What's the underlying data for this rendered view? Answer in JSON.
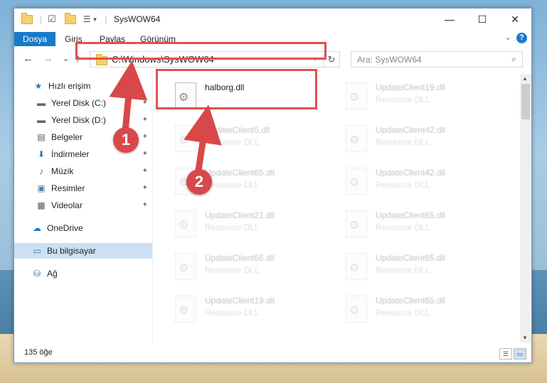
{
  "window": {
    "title": "SysWOW64"
  },
  "titlebar": {
    "minimize": "—",
    "maximize": "☐",
    "close": "✕"
  },
  "ribbon": {
    "tabs": [
      "Dosya",
      "Giriş",
      "Paylaş",
      "Görünüm"
    ],
    "help": "?"
  },
  "navigation": {
    "back": "←",
    "forward": "→",
    "recent": "⌄",
    "up": "↑",
    "address": "C:\\Windows\\SysWOW64",
    "refresh": "↻",
    "search_placeholder": "Ara: SysWOW64",
    "search_icon": "⌕"
  },
  "sidebar": {
    "items": [
      {
        "label": "Hızlı erişim",
        "icon": "★"
      },
      {
        "label": "Yerel Disk (C:)",
        "icon": "▬",
        "pinned": "📌"
      },
      {
        "label": "Yerel Disk (D:)",
        "icon": "▬",
        "pinned": "📌"
      },
      {
        "label": "Belgeler",
        "icon": "▤",
        "pinned": "📌"
      },
      {
        "label": "İndirmeler",
        "icon": "⬇",
        "pinned": "📌"
      },
      {
        "label": "Müzik",
        "icon": "♪",
        "pinned": "📌"
      },
      {
        "label": "Resimler",
        "icon": "▣",
        "pinned": "📌"
      },
      {
        "label": "Videolar",
        "icon": "▦",
        "pinned": "📌"
      },
      {
        "label": "OneDrive",
        "icon": "☁"
      },
      {
        "label": "Bu bilgisayar",
        "icon": "▭"
      },
      {
        "label": "Ağ",
        "icon": "⛁"
      }
    ]
  },
  "files": [
    {
      "name": "halborg.dll",
      "type": ""
    },
    {
      "name": "UpdateClient19.dll",
      "type": "Resource DLL"
    },
    {
      "name": "UpdateClient5.dll",
      "type": "Resource DLL"
    },
    {
      "name": "UpdateClient42.dll",
      "type": "Resource DLL"
    },
    {
      "name": "UpdateClient65.dll",
      "type": "Resource DLL"
    },
    {
      "name": "UpdateClient42.dll",
      "type": "Resource DLL"
    },
    {
      "name": "UpdateClient21.dll",
      "type": "Resource DLL"
    },
    {
      "name": "UpdateClient65.dll",
      "type": "Resource DLL"
    },
    {
      "name": "UpdateClient65.dll",
      "type": "Resource DLL"
    },
    {
      "name": "UpdateClient65.dll",
      "type": "Resource DLL"
    },
    {
      "name": "UpdateClient19.dll",
      "type": "Resource DLL"
    },
    {
      "name": "UpdateClient65.dll",
      "type": "Resource DLL"
    }
  ],
  "status": {
    "count": "135 öğe"
  },
  "annotations": {
    "callout1": "1",
    "callout2": "2"
  },
  "colors": {
    "accent": "#1979ca",
    "highlight": "#e05050",
    "callout": "#d94848",
    "selected": "#cce0f4"
  }
}
